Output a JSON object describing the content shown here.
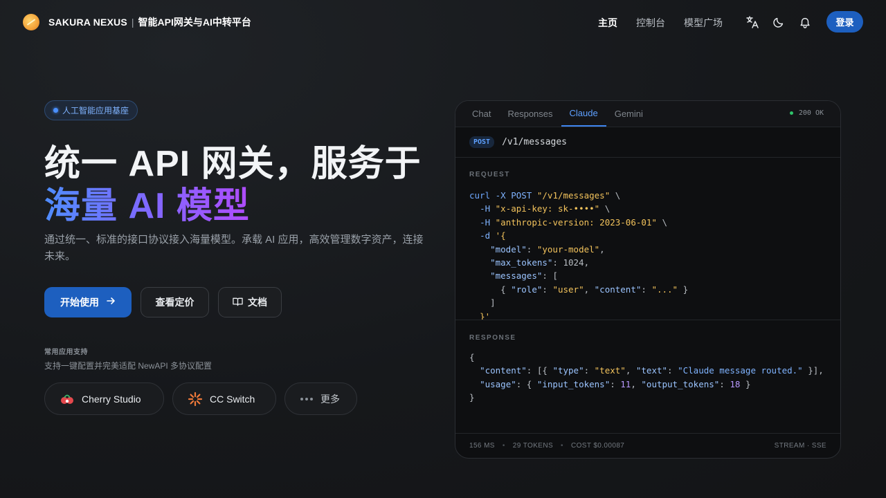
{
  "header": {
    "brand": "SAKURA NEXUS",
    "separator": "|",
    "tagline": "智能API网关与AI中转平台",
    "nav": [
      {
        "label": "主页",
        "active": true
      },
      {
        "label": "控制台",
        "active": false
      },
      {
        "label": "模型广场",
        "active": false
      }
    ],
    "icons": [
      "translate-icon",
      "moon-icon",
      "bell-icon"
    ],
    "login_label": "登录"
  },
  "hero": {
    "badge": "人工智能应用基座",
    "title_line1": "统一 API 网关，服务于",
    "title_line2": "海量 AI 模型",
    "description": "通过统一、标准的接口协议接入海量模型。承载 AI 应用，高效管理数字资产，连接未来。",
    "buttons": {
      "start": "开始使用",
      "pricing": "查看定价",
      "docs": "文档"
    },
    "support_title": "常用应用支持",
    "support_desc": "支持一键配置并完美适配 NewAPI 多协议配置",
    "apps": [
      {
        "label": "Cherry Studio",
        "icon": "cherry-icon"
      },
      {
        "label": "CC Switch",
        "icon": "sunburst-icon"
      },
      {
        "label": "更多",
        "icon": "more-dots-icon"
      }
    ]
  },
  "panel": {
    "tabs": [
      {
        "label": "Chat",
        "active": false
      },
      {
        "label": "Responses",
        "active": false
      },
      {
        "label": "Claude",
        "active": true
      },
      {
        "label": "Gemini",
        "active": false
      }
    ],
    "status": "200 OK",
    "method": "POST",
    "path": "/v1/messages",
    "request_label": "REQUEST",
    "response_label": "RESPONSE",
    "footer": {
      "latency": "156 MS",
      "tokens": "29 TOKENS",
      "cost": "COST $0.00087",
      "mode": "STREAM · SSE"
    }
  },
  "colors": {
    "accent": "#1d5fbf",
    "active_tab": "#5ea0ff",
    "status_ok": "#2fc46b",
    "gradient_start": "#4f8dff",
    "gradient_end": "#b04cff"
  }
}
